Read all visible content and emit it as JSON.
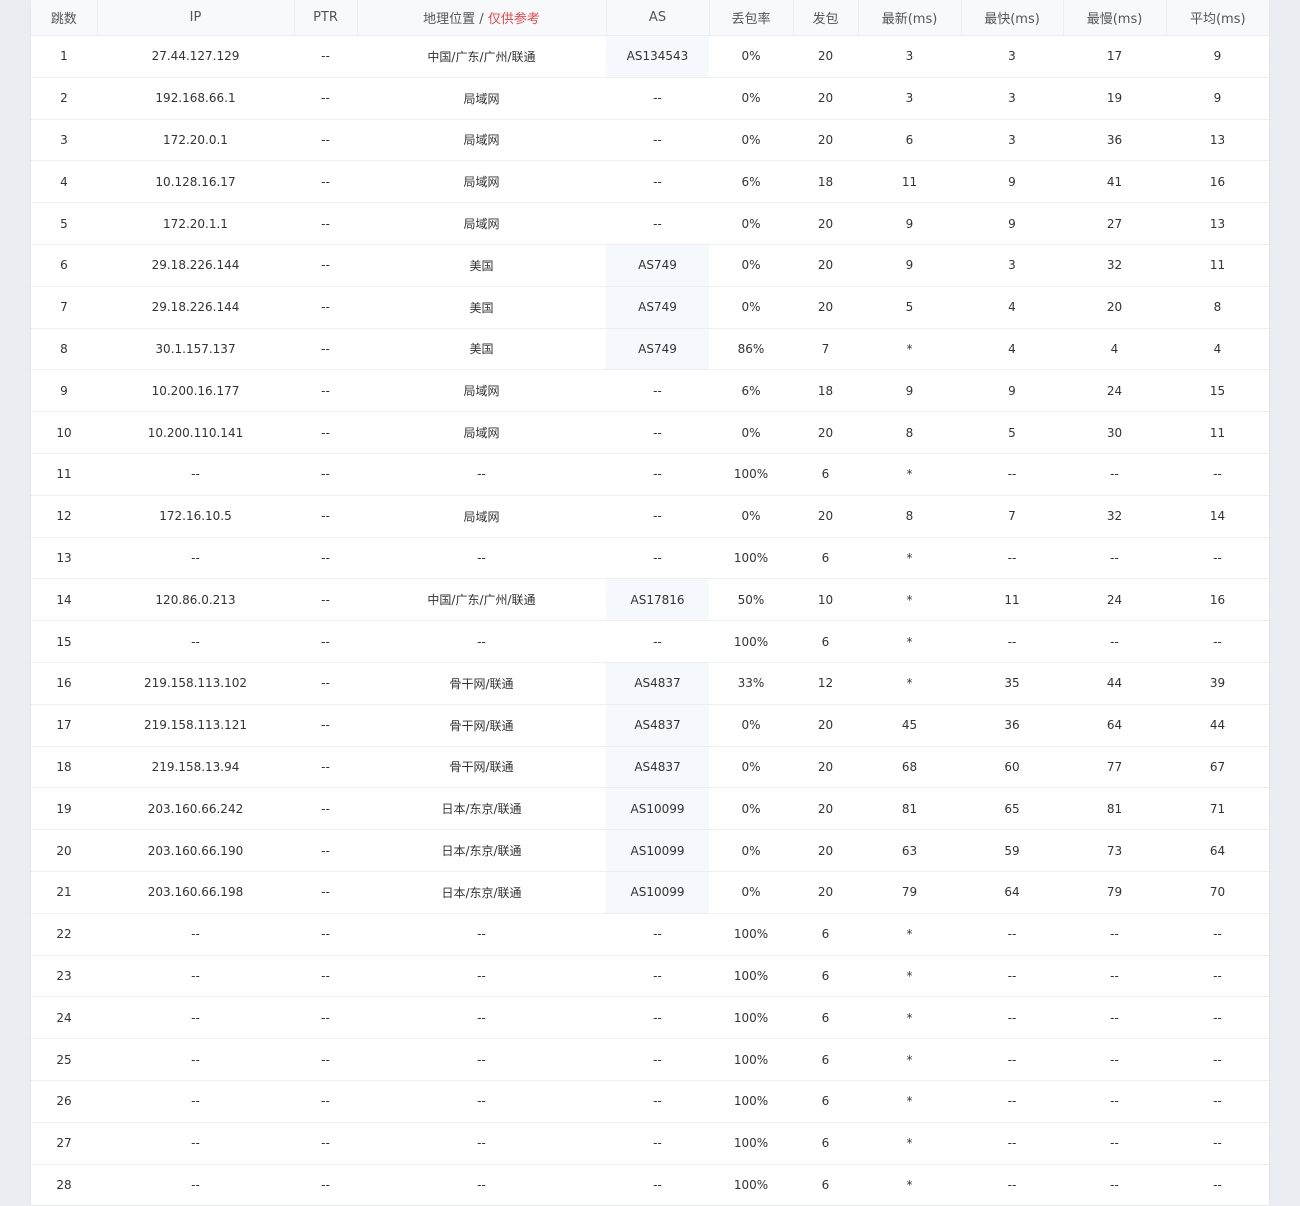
{
  "table": {
    "headers": {
      "hop": "跳数",
      "ip": "IP",
      "ptr": "PTR",
      "geo": "地理位置",
      "geo_sep": " / ",
      "geo_note": "仅供参考",
      "as": "AS",
      "loss": "丢包率",
      "sent": "发包",
      "last": "最新(ms)",
      "best": "最快(ms)",
      "worst": "最慢(ms)",
      "avg": "平均(ms)"
    },
    "rows": [
      {
        "hop": "1",
        "ip": "27.44.127.129",
        "ptr": "--",
        "geo": "中国/广东/广州/联通",
        "as": "AS134543",
        "loss": "0%",
        "sent": "20",
        "last": "3",
        "best": "3",
        "worst": "17",
        "avg": "9"
      },
      {
        "hop": "2",
        "ip": "192.168.66.1",
        "ptr": "--",
        "geo": "局域网",
        "as": "--",
        "loss": "0%",
        "sent": "20",
        "last": "3",
        "best": "3",
        "worst": "19",
        "avg": "9"
      },
      {
        "hop": "3",
        "ip": "172.20.0.1",
        "ptr": "--",
        "geo": "局域网",
        "as": "--",
        "loss": "0%",
        "sent": "20",
        "last": "6",
        "best": "3",
        "worst": "36",
        "avg": "13"
      },
      {
        "hop": "4",
        "ip": "10.128.16.17",
        "ptr": "--",
        "geo": "局域网",
        "as": "--",
        "loss": "6%",
        "sent": "18",
        "last": "11",
        "best": "9",
        "worst": "41",
        "avg": "16"
      },
      {
        "hop": "5",
        "ip": "172.20.1.1",
        "ptr": "--",
        "geo": "局域网",
        "as": "--",
        "loss": "0%",
        "sent": "20",
        "last": "9",
        "best": "9",
        "worst": "27",
        "avg": "13"
      },
      {
        "hop": "6",
        "ip": "29.18.226.144",
        "ptr": "--",
        "geo": "美国",
        "as": "AS749",
        "loss": "0%",
        "sent": "20",
        "last": "9",
        "best": "3",
        "worst": "32",
        "avg": "11"
      },
      {
        "hop": "7",
        "ip": "29.18.226.144",
        "ptr": "--",
        "geo": "美国",
        "as": "AS749",
        "loss": "0%",
        "sent": "20",
        "last": "5",
        "best": "4",
        "worst": "20",
        "avg": "8"
      },
      {
        "hop": "8",
        "ip": "30.1.157.137",
        "ptr": "--",
        "geo": "美国",
        "as": "AS749",
        "loss": "86%",
        "sent": "7",
        "last": "*",
        "best": "4",
        "worst": "4",
        "avg": "4"
      },
      {
        "hop": "9",
        "ip": "10.200.16.177",
        "ptr": "--",
        "geo": "局域网",
        "as": "--",
        "loss": "6%",
        "sent": "18",
        "last": "9",
        "best": "9",
        "worst": "24",
        "avg": "15"
      },
      {
        "hop": "10",
        "ip": "10.200.110.141",
        "ptr": "--",
        "geo": "局域网",
        "as": "--",
        "loss": "0%",
        "sent": "20",
        "last": "8",
        "best": "5",
        "worst": "30",
        "avg": "11"
      },
      {
        "hop": "11",
        "ip": "--",
        "ptr": "--",
        "geo": "--",
        "as": "--",
        "loss": "100%",
        "sent": "6",
        "last": "*",
        "best": "--",
        "worst": "--",
        "avg": "--"
      },
      {
        "hop": "12",
        "ip": "172.16.10.5",
        "ptr": "--",
        "geo": "局域网",
        "as": "--",
        "loss": "0%",
        "sent": "20",
        "last": "8",
        "best": "7",
        "worst": "32",
        "avg": "14"
      },
      {
        "hop": "13",
        "ip": "--",
        "ptr": "--",
        "geo": "--",
        "as": "--",
        "loss": "100%",
        "sent": "6",
        "last": "*",
        "best": "--",
        "worst": "--",
        "avg": "--"
      },
      {
        "hop": "14",
        "ip": "120.86.0.213",
        "ptr": "--",
        "geo": "中国/广东/广州/联通",
        "as": "AS17816",
        "loss": "50%",
        "sent": "10",
        "last": "*",
        "best": "11",
        "worst": "24",
        "avg": "16"
      },
      {
        "hop": "15",
        "ip": "--",
        "ptr": "--",
        "geo": "--",
        "as": "--",
        "loss": "100%",
        "sent": "6",
        "last": "*",
        "best": "--",
        "worst": "--",
        "avg": "--"
      },
      {
        "hop": "16",
        "ip": "219.158.113.102",
        "ptr": "--",
        "geo": "骨干网/联通",
        "as": "AS4837",
        "loss": "33%",
        "sent": "12",
        "last": "*",
        "best": "35",
        "worst": "44",
        "avg": "39"
      },
      {
        "hop": "17",
        "ip": "219.158.113.121",
        "ptr": "--",
        "geo": "骨干网/联通",
        "as": "AS4837",
        "loss": "0%",
        "sent": "20",
        "last": "45",
        "best": "36",
        "worst": "64",
        "avg": "44"
      },
      {
        "hop": "18",
        "ip": "219.158.13.94",
        "ptr": "--",
        "geo": "骨干网/联通",
        "as": "AS4837",
        "loss": "0%",
        "sent": "20",
        "last": "68",
        "best": "60",
        "worst": "77",
        "avg": "67"
      },
      {
        "hop": "19",
        "ip": "203.160.66.242",
        "ptr": "--",
        "geo": "日本/东京/联通",
        "as": "AS10099",
        "loss": "0%",
        "sent": "20",
        "last": "81",
        "best": "65",
        "worst": "81",
        "avg": "71"
      },
      {
        "hop": "20",
        "ip": "203.160.66.190",
        "ptr": "--",
        "geo": "日本/东京/联通",
        "as": "AS10099",
        "loss": "0%",
        "sent": "20",
        "last": "63",
        "best": "59",
        "worst": "73",
        "avg": "64"
      },
      {
        "hop": "21",
        "ip": "203.160.66.198",
        "ptr": "--",
        "geo": "日本/东京/联通",
        "as": "AS10099",
        "loss": "0%",
        "sent": "20",
        "last": "79",
        "best": "64",
        "worst": "79",
        "avg": "70"
      },
      {
        "hop": "22",
        "ip": "--",
        "ptr": "--",
        "geo": "--",
        "as": "--",
        "loss": "100%",
        "sent": "6",
        "last": "*",
        "best": "--",
        "worst": "--",
        "avg": "--"
      },
      {
        "hop": "23",
        "ip": "--",
        "ptr": "--",
        "geo": "--",
        "as": "--",
        "loss": "100%",
        "sent": "6",
        "last": "*",
        "best": "--",
        "worst": "--",
        "avg": "--"
      },
      {
        "hop": "24",
        "ip": "--",
        "ptr": "--",
        "geo": "--",
        "as": "--",
        "loss": "100%",
        "sent": "6",
        "last": "*",
        "best": "--",
        "worst": "--",
        "avg": "--"
      },
      {
        "hop": "25",
        "ip": "--",
        "ptr": "--",
        "geo": "--",
        "as": "--",
        "loss": "100%",
        "sent": "6",
        "last": "*",
        "best": "--",
        "worst": "--",
        "avg": "--"
      },
      {
        "hop": "26",
        "ip": "--",
        "ptr": "--",
        "geo": "--",
        "as": "--",
        "loss": "100%",
        "sent": "6",
        "last": "*",
        "best": "--",
        "worst": "--",
        "avg": "--"
      },
      {
        "hop": "27",
        "ip": "--",
        "ptr": "--",
        "geo": "--",
        "as": "--",
        "loss": "100%",
        "sent": "6",
        "last": "*",
        "best": "--",
        "worst": "--",
        "avg": "--"
      },
      {
        "hop": "28",
        "ip": "--",
        "ptr": "--",
        "geo": "--",
        "as": "--",
        "loss": "100%",
        "sent": "6",
        "last": "*",
        "best": "--",
        "worst": "--",
        "avg": "--"
      }
    ]
  },
  "colors": {
    "accent_link": "#3d8bf2",
    "warning": "#f0484a",
    "page_bg": "#eaeef3"
  }
}
